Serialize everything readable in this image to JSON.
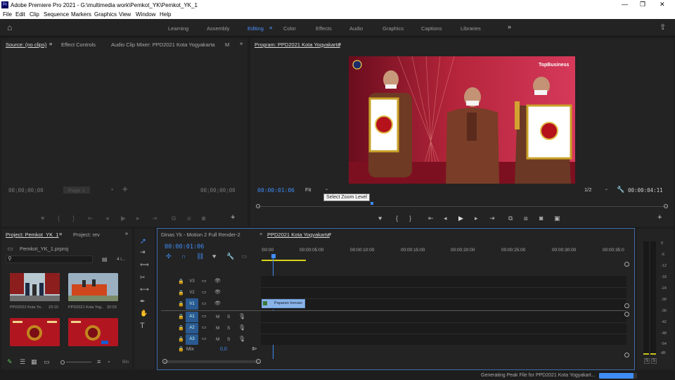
{
  "window": {
    "title": "Adobe Premiere Pro 2021 - G:\\multimedia work\\Pemkot_YK\\Pemkot_YK_1",
    "logo": "Pr"
  },
  "menu": [
    "File",
    "Edit",
    "Clip",
    "Sequence",
    "Markers",
    "Graphics",
    "View",
    "Window",
    "Help"
  ],
  "workspaces": [
    "Learning",
    "Assembly",
    "Editing",
    "Color",
    "Effects",
    "Audio",
    "Graphics",
    "Captions",
    "Libraries"
  ],
  "active_workspace": "Editing",
  "source": {
    "tabs": [
      "Source: (no clips)",
      "Effect Controls",
      "Audio Clip Mixer: PPD2021 Kota Yogyakarta",
      "M"
    ],
    "timecode_left": "00;00;00;00",
    "page": "Page 1",
    "timecode_right": "00;00;00;00"
  },
  "program": {
    "tab": "Program: PPD2021 Kota Yogyakarta",
    "timecode": "00:00:01:06",
    "zoom": "Fit",
    "tooltip": "Select Zoom Level",
    "resolution": "1/2",
    "duration": "00:00:04:11",
    "watermark": "TopBusiness"
  },
  "project": {
    "tabs": [
      "Project: Pemkot_YK_1",
      "Project: rev"
    ],
    "file": "Pemkot_YK_1.prproj",
    "count": "4 i...",
    "items": [
      {
        "name": "PPD2022 Kota Yo..",
        "duration": "23:10"
      },
      {
        "name": "PPD2021 Kota Yog..",
        "duration": "32:03"
      },
      {
        "name": "",
        "duration": ""
      },
      {
        "name": "",
        "duration": ""
      }
    ],
    "bin_label": "Bin"
  },
  "timeline": {
    "tabs": [
      "Dinas Yk - Motion 2 Full Render-2",
      "PPD2021 Kota Yogyakarta"
    ],
    "timecode": "00:00:01:06",
    "ruler": [
      ":00:00",
      "00:00:05:00",
      "00:00:10:00",
      "00:00:15:00",
      "00:00:20:00",
      "00:00:25:00",
      "00:00:30:00",
      "00:00:35:0"
    ],
    "video_tracks": [
      "V3",
      "V2",
      "V1"
    ],
    "audio_tracks": [
      "A1",
      "A2",
      "A3"
    ],
    "mix_label": "Mix",
    "mix_value": "0,0",
    "clip": "Paparan Inovasi",
    "track_buttons": {
      "mute": "M",
      "solo": "S"
    }
  },
  "meter": {
    "ticks": [
      "0",
      "-6",
      "-12",
      "-18",
      "-24",
      "-30",
      "-36",
      "-42",
      "-48",
      "-54",
      "dB"
    ],
    "buttons": [
      "S",
      "S"
    ]
  },
  "status": {
    "text": "Generating Peak File for PPD2021 Kota Yogyakart...",
    "progress": 0.9
  },
  "colors": {
    "accent": "#3f8cf5",
    "clip": "#8ab4e8",
    "panel": "#232323"
  }
}
